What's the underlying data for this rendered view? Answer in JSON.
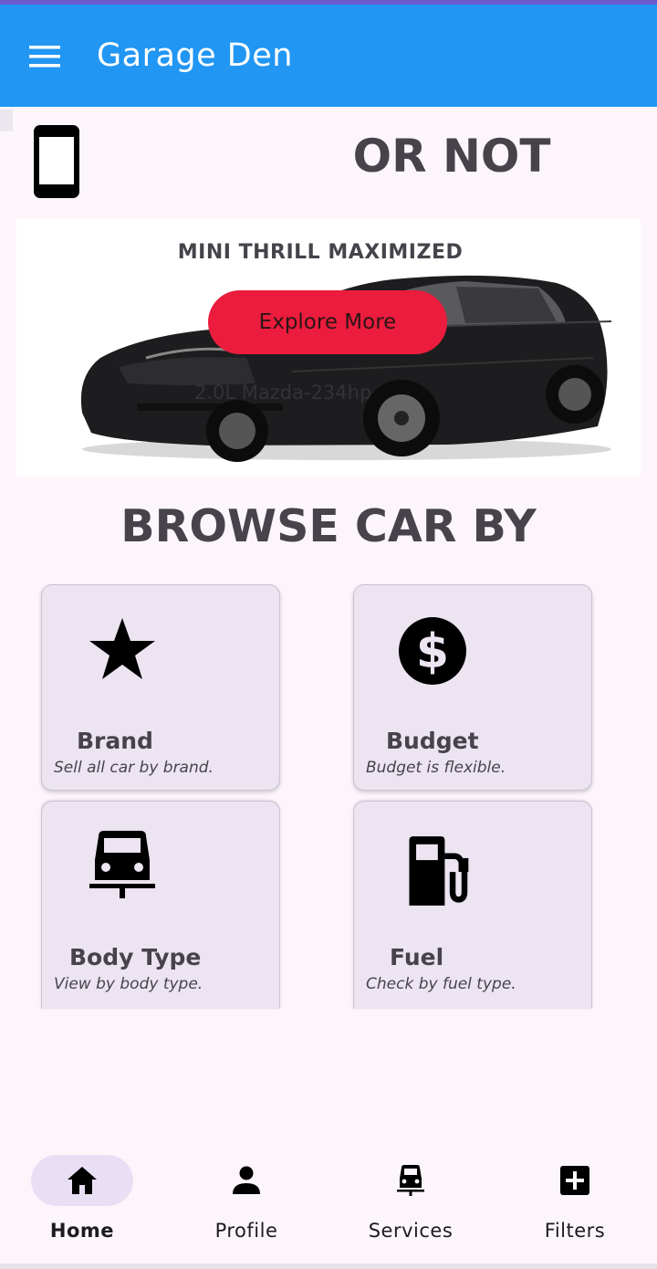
{
  "app_bar": {
    "title": "Garage Den",
    "menu_icon": "hamburger-menu-icon"
  },
  "hero": {
    "icon": "phone-icon",
    "headline": "OR NOT"
  },
  "banner": {
    "title": "MINI THRILL MAXIMIZED",
    "button_label": "Explore More",
    "car_caption": "2.0L Mazda-234hp"
  },
  "browse": {
    "title": "BROWSE CAR BY",
    "cards": [
      {
        "icon": "star-icon",
        "title": "Brand",
        "subtitle": "Sell all car by brand."
      },
      {
        "icon": "dollar-circle-icon",
        "title": "Budget",
        "subtitle": "Budget is flexible."
      },
      {
        "icon": "car-icon",
        "title": "Body Type",
        "subtitle": "View by body type."
      },
      {
        "icon": "fuel-pump-icon",
        "title": "Fuel",
        "subtitle": "Check by fuel type."
      }
    ]
  },
  "bottom_nav": {
    "selected": "Home",
    "items": [
      {
        "label": "Home",
        "icon": "home-icon"
      },
      {
        "label": "Profile",
        "icon": "person-icon"
      },
      {
        "label": "Services",
        "icon": "car-icon"
      },
      {
        "label": "Filters",
        "icon": "add-box-icon"
      }
    ]
  },
  "colors": {
    "app_bar": "#2196f3",
    "accent_button": "#eb1c3d",
    "card_bg": "#ede4f2",
    "nav_pill": "#e9dff5",
    "page_bg": "#fcf6fc"
  }
}
